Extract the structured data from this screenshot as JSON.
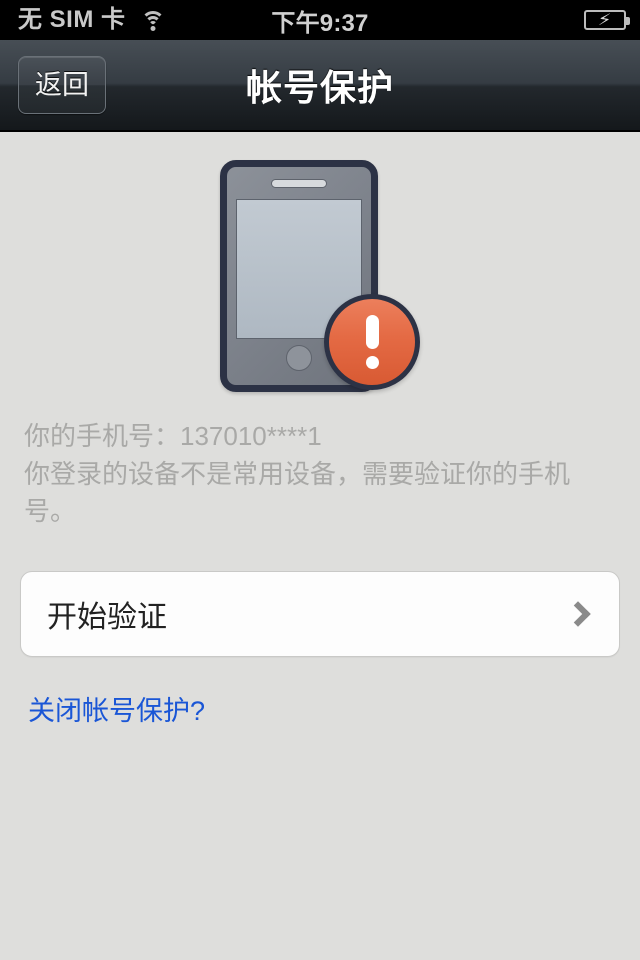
{
  "status_bar": {
    "carrier": "无 SIM 卡",
    "wifi_icon": "wifi-icon",
    "time": "下午9:37",
    "battery_icon": "battery-charging-icon",
    "battery_bolt": "⚡"
  },
  "nav_bar": {
    "back_label": "返回",
    "title": "帐号保护"
  },
  "hero": {
    "illustration": "phone-with-alert-illustration",
    "alert_icon": "exclamation-icon"
  },
  "info": {
    "phone_line": "你的手机号：137010****1",
    "description": "你登录的设备不是常用设备，需要验证你的手机号。"
  },
  "action_cell": {
    "label": "开始验证",
    "chevron_icon": "chevron-right-icon"
  },
  "link": {
    "label": "关闭帐号保护?"
  },
  "colors": {
    "background": "#dededc",
    "nav_bar_dark": "#23282d",
    "alert_orange": "#e46a44",
    "phone_outline": "#2c3245",
    "link_blue": "#1a56d6",
    "muted_text": "#a9a9a7"
  }
}
